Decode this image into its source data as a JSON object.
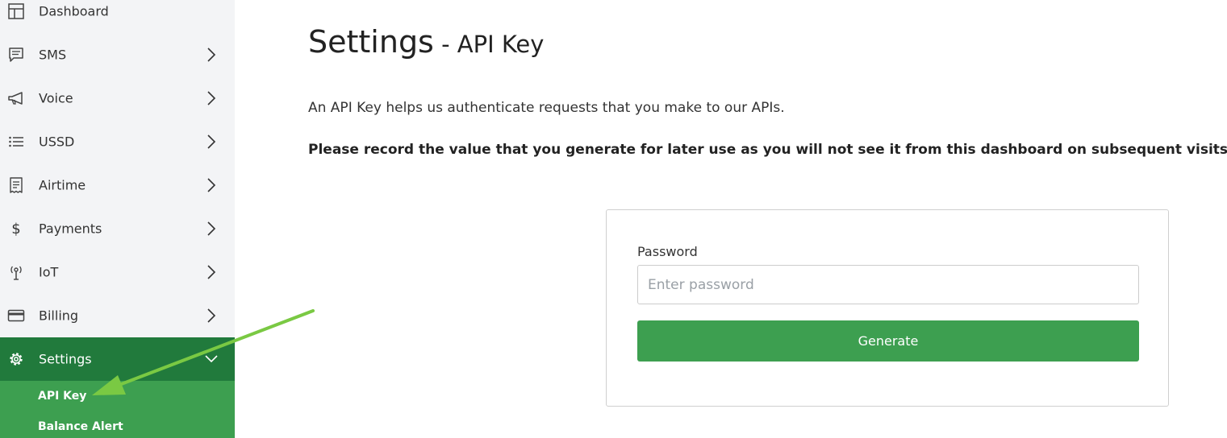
{
  "sidebar": {
    "items": [
      {
        "label": "Dashboard",
        "icon": "dashboard-icon"
      },
      {
        "label": "SMS",
        "icon": "message-icon"
      },
      {
        "label": "Voice",
        "icon": "megaphone-icon"
      },
      {
        "label": "USSD",
        "icon": "list-icon"
      },
      {
        "label": "Airtime",
        "icon": "receipt-icon"
      },
      {
        "label": "Payments",
        "icon": "dollar-icon"
      },
      {
        "label": "IoT",
        "icon": "antenna-icon"
      },
      {
        "label": "Billing",
        "icon": "credit-card-icon"
      },
      {
        "label": "Settings",
        "icon": "gear-icon"
      }
    ],
    "submenu": [
      {
        "label": "API Key"
      },
      {
        "label": "Balance Alert"
      }
    ]
  },
  "main": {
    "title": "Settings",
    "title_sep": " - ",
    "subtitle": "API Key",
    "intro": "An API Key helps us authenticate requests that you make to our APIs.",
    "note": "Please record the value that you generate for later use as you will not see it from this dashboard on subsequent visits.",
    "form": {
      "password_label": "Password",
      "password_placeholder": "Enter password",
      "password_value": "",
      "button_label": "Generate"
    }
  },
  "colors": {
    "sidebar_bg": "#f3f4f6",
    "active_item": "#217a3c",
    "submenu_bg": "#3d9f50",
    "button": "#3d9f50",
    "annotation_arrow": "#7ac943"
  }
}
